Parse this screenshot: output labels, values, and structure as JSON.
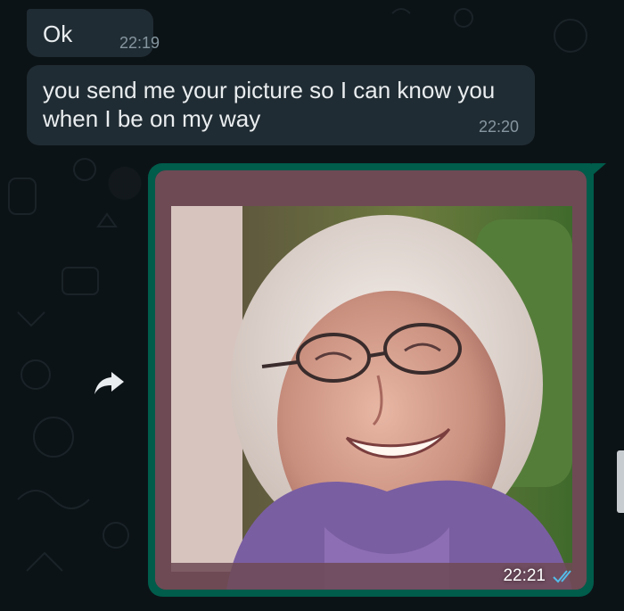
{
  "messages": [
    {
      "direction": "incoming",
      "text": "Ok",
      "time": "22:19"
    },
    {
      "direction": "incoming",
      "text": "you send me your picture so I can know you when I be on my way",
      "time": "22:20"
    },
    {
      "direction": "outgoing",
      "type": "photo",
      "time": "22:21",
      "status": "read"
    }
  ],
  "icons": {
    "forward": "forward-arrow-icon",
    "read_receipt": "double-check-icon"
  },
  "colors": {
    "background": "#0b141a",
    "incoming_bubble": "#202c33",
    "outgoing_bubble": "#005c4b",
    "time_text": "#8696a0",
    "read_tick": "#53bdeb"
  }
}
